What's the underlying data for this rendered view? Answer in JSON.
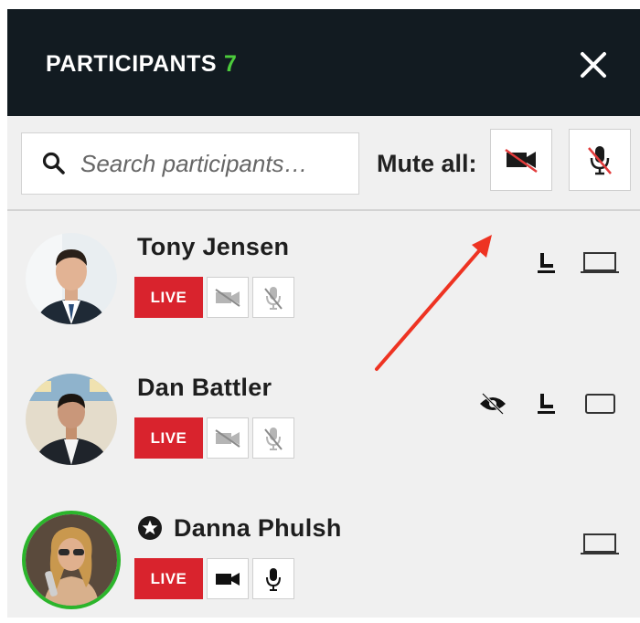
{
  "header": {
    "title": "PARTICIPANTS",
    "count": "7",
    "close_icon": "close-icon"
  },
  "toolbar": {
    "search_placeholder": "Search participants…",
    "search_value": "",
    "mute_all_label": "Mute all:",
    "mute_video_icon": "video-off-icon",
    "mute_audio_icon": "mic-off-icon"
  },
  "participants": [
    {
      "name": "Tony Jensen",
      "live_label": "LIVE",
      "video": "off",
      "audio": "off",
      "speaking": false,
      "host": false,
      "right_icons": [
        "seat-icon",
        "screen-icon"
      ]
    },
    {
      "name": "Dan Battler",
      "live_label": "LIVE",
      "video": "off",
      "audio": "off",
      "speaking": false,
      "host": false,
      "right_icons": [
        "hidden-eye-icon",
        "seat-icon",
        "screen-icon"
      ]
    },
    {
      "name": "Danna Phulsh",
      "live_label": "LIVE",
      "video": "on",
      "audio": "on",
      "speaking": true,
      "host": true,
      "right_icons": [
        "screen-icon"
      ]
    }
  ],
  "colors": {
    "header_bg": "#121b21",
    "count_green": "#4ccc3c",
    "live_red": "#d9232d",
    "speaking_ring": "#2bb52b",
    "annotation_arrow": "#ee3322"
  }
}
